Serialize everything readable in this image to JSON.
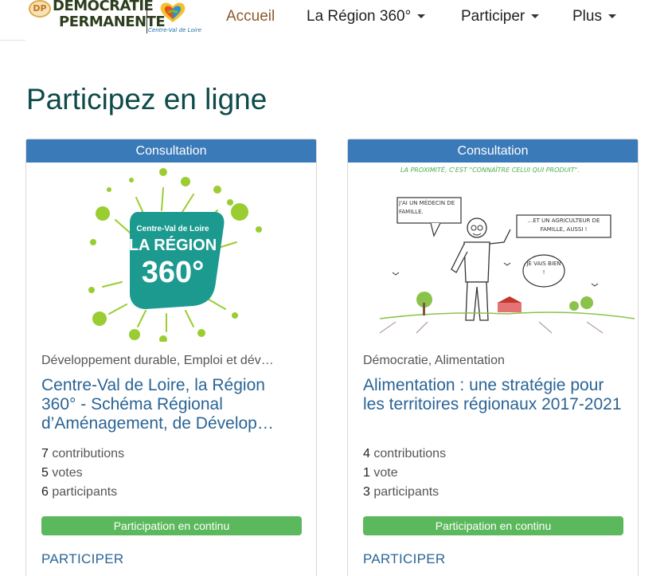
{
  "header": {
    "brand_badge": "DP",
    "brand_line1": "DÉMOCRATIE",
    "brand_line2": "PERMANENTE",
    "region_label": "Centre-Val de Loire",
    "nav": [
      {
        "label": "Accueil"
      },
      {
        "label": "La Région 360°"
      },
      {
        "label": "Participer"
      },
      {
        "label": "Plus"
      }
    ]
  },
  "page": {
    "title": "Participez en ligne"
  },
  "cards": [
    {
      "type": "Consultation",
      "logo_line1": "Centre-Val de Loire",
      "logo_line2": "LA RÉGION",
      "logo_line3": "360°",
      "categories": "Développement durable, Emploi et dév…",
      "title": "Centre-Val de Loire, la Région 360° - Schéma Régional d’Aménagement, de Dévelop…",
      "contributions_count": "7",
      "contributions_label": "contributions",
      "votes_count": "5",
      "votes_label": "votes",
      "participants_count": "6",
      "participants_label": "participants",
      "status": "Participation en continu",
      "cta": "PARTICIPER"
    },
    {
      "type": "Consultation",
      "cartoon_caption": "LA PROXIMITÉ, C'EST \"CONNAÎTRE CELUI QUI PRODUIT\".",
      "bubble1": "J'AI UN MÉDECIN DE FAMILLE.",
      "bubble2": "...ET UN AGRICULTEUR DE FAMILLE, AUSSI !",
      "bubble3": "JE VAIS BIEN !",
      "categories": "Démocratie, Alimentation",
      "title": "Alimentation : une stratégie pour les territoires régionaux 2017-2021",
      "contributions_count": "4",
      "contributions_label": "contributions",
      "votes_count": "1",
      "votes_label": "vote",
      "participants_count": "3",
      "participants_label": "participants",
      "status": "Participation en continu",
      "cta": "PARTICIPER"
    }
  ],
  "colors": {
    "card_header": "#3a7ab8",
    "status_pill": "#5cb85c",
    "link": "#2a6496",
    "nav_active": "#8b5a2b",
    "title": "#0f4a4a"
  }
}
